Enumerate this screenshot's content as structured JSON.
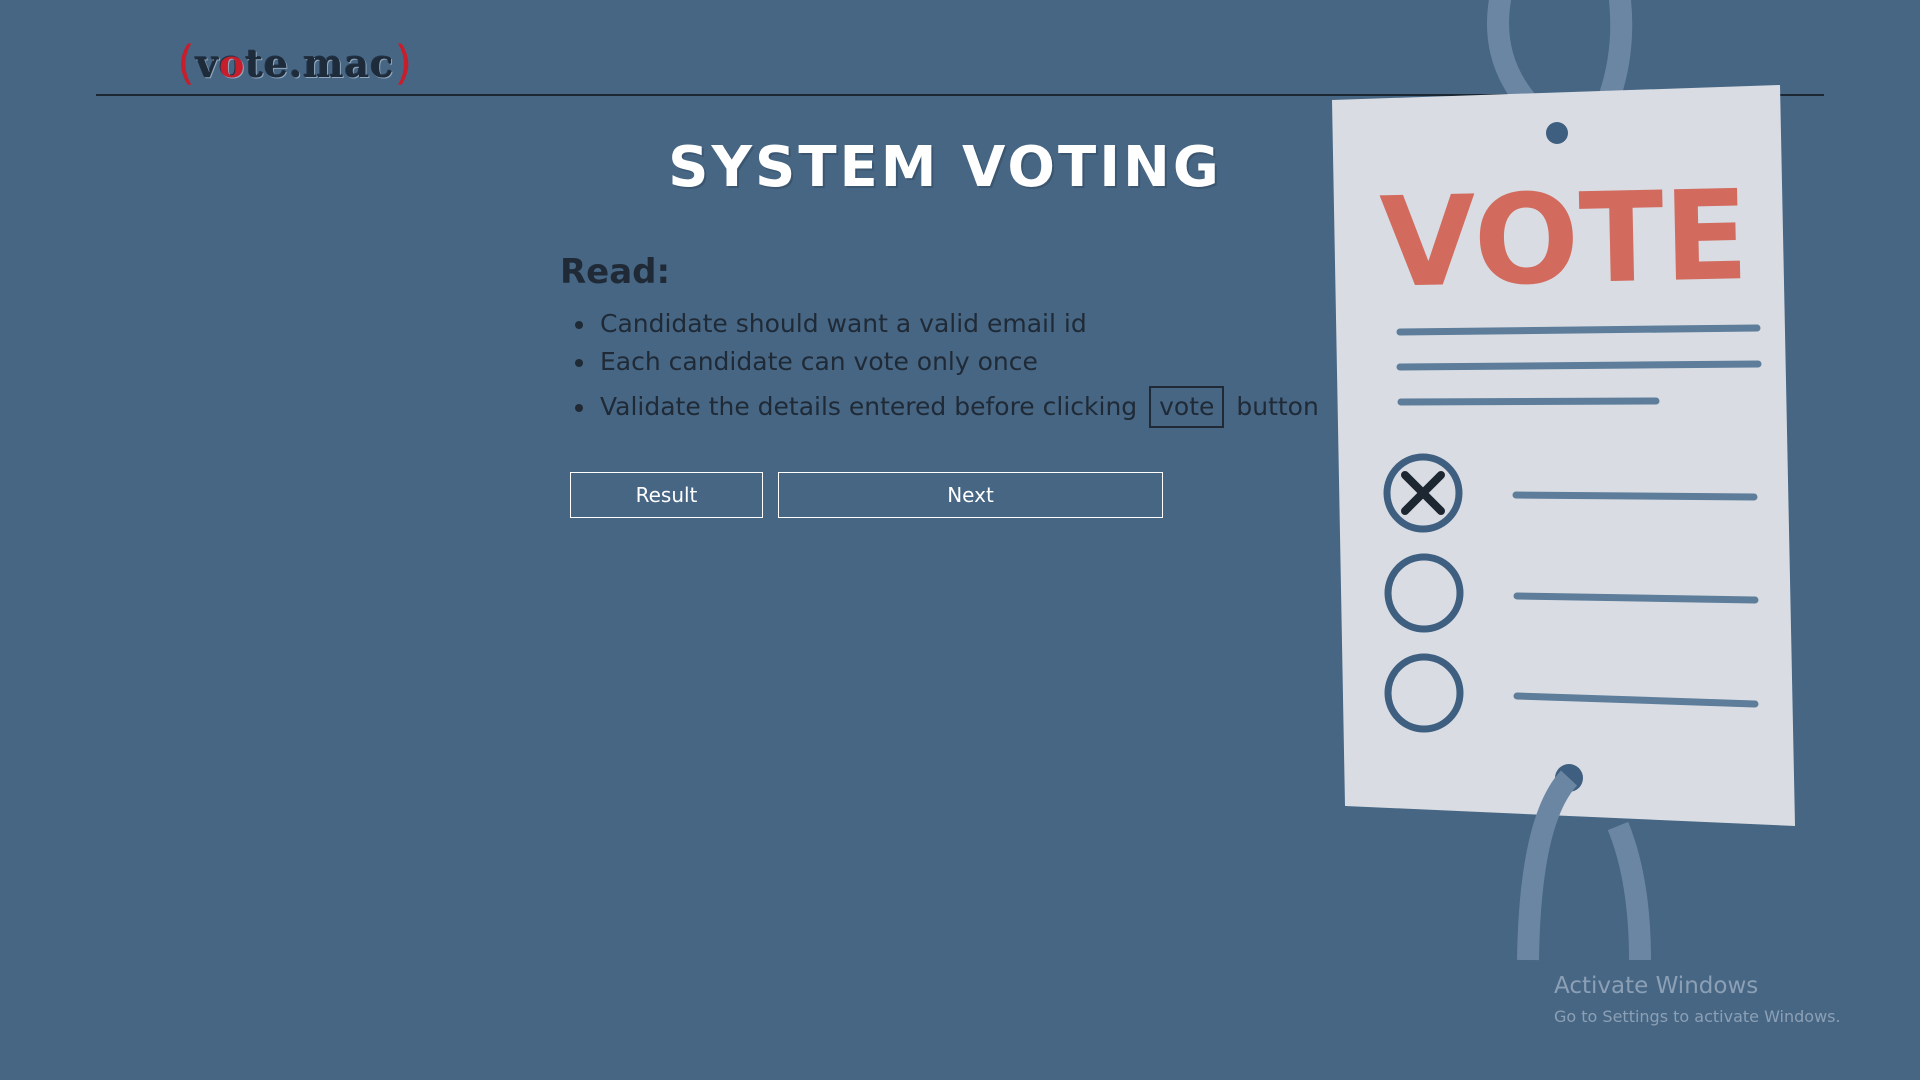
{
  "logo": {
    "open_paren": "(",
    "part1": "v",
    "red_o": "o",
    "part2": "te.mac",
    "close_paren": ")"
  },
  "title": "SYSTEM VOTING",
  "read": {
    "heading": "Read:",
    "rules": [
      "Candidate should want a valid email id",
      "Each candidate can vote only once"
    ],
    "rule3_before": "Validate the details entered before clicking",
    "rule3_chip": "vote",
    "rule3_after": "button"
  },
  "buttons": {
    "result": "Result",
    "next": "Next"
  },
  "illustration": {
    "ballot_word": "VOTE"
  },
  "watermark": {
    "title": "Activate Windows",
    "subtitle": "Go to Settings to activate Windows."
  },
  "colors": {
    "background": "#466684",
    "paper": "#d9dde3",
    "vote_red": "#d26b5e",
    "ink_blue": "#3f5f80"
  }
}
